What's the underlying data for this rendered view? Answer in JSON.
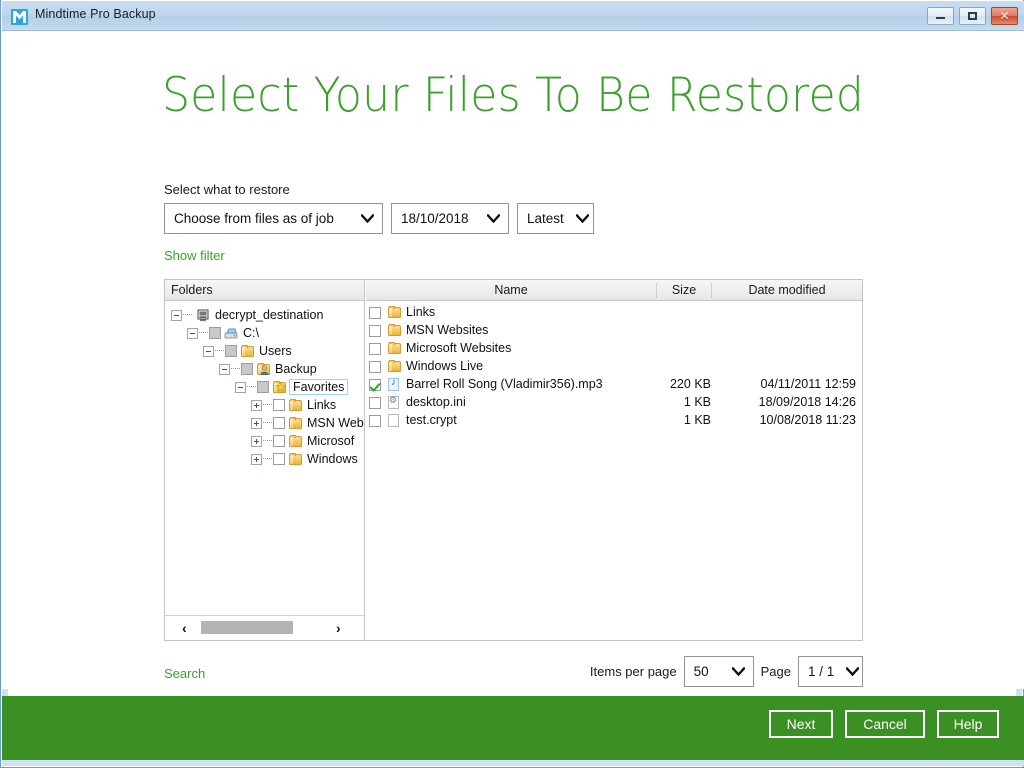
{
  "window": {
    "title": "Mindtime Pro Backup",
    "logo_icon": "mindtime-logo-icon",
    "buttons": {
      "minimize": "minimize-icon",
      "maximize": "maximize-icon",
      "close": "close-icon"
    }
  },
  "page": {
    "heading": "Select Your Files To Be Restored",
    "restore_label": "Select what to restore",
    "show_filter": "Show filter",
    "search": "Search"
  },
  "selectors": {
    "job": "Choose from files as of job",
    "date": "18/10/2018",
    "version": "Latest"
  },
  "tree": {
    "header": "Folders",
    "nodes": [
      {
        "label": "decrypt_destination",
        "depth": 0,
        "expander": "minus",
        "checkbox": "none",
        "icon": "computer-icon",
        "selected": false
      },
      {
        "label": "C:\\",
        "depth": 1,
        "expander": "minus",
        "checkbox": "partial",
        "icon": "drive-icon",
        "selected": false
      },
      {
        "label": "Users",
        "depth": 2,
        "expander": "minus",
        "checkbox": "partial",
        "icon": "folder-icon",
        "selected": false
      },
      {
        "label": "Backup",
        "depth": 3,
        "expander": "minus",
        "checkbox": "partial",
        "icon": "folder-user-icon",
        "selected": false
      },
      {
        "label": "Favorites",
        "depth": 4,
        "expander": "minus",
        "checkbox": "partial",
        "icon": "folder-star-icon",
        "selected": true
      },
      {
        "label": "Links",
        "depth": 5,
        "expander": "plus",
        "checkbox": "empty",
        "icon": "folder-icon",
        "selected": false
      },
      {
        "label": "MSN Web",
        "depth": 5,
        "expander": "plus",
        "checkbox": "empty",
        "icon": "folder-icon",
        "selected": false
      },
      {
        "label": "Microsof",
        "depth": 5,
        "expander": "plus",
        "checkbox": "empty",
        "icon": "folder-icon",
        "selected": false
      },
      {
        "label": "Windows",
        "depth": 5,
        "expander": "plus",
        "checkbox": "empty",
        "icon": "folder-icon",
        "selected": false
      }
    ],
    "scrollbar": {
      "left_arrow": "‹",
      "right_arrow": "›"
    }
  },
  "filelist": {
    "columns": [
      "Name",
      "Size",
      "Date modified"
    ],
    "rows": [
      {
        "name": "Links",
        "size": "",
        "date": "",
        "checked": false,
        "icon": "folder-icon"
      },
      {
        "name": "MSN Websites",
        "size": "",
        "date": "",
        "checked": false,
        "icon": "folder-icon"
      },
      {
        "name": "Microsoft Websites",
        "size": "",
        "date": "",
        "checked": false,
        "icon": "folder-icon"
      },
      {
        "name": "Windows Live",
        "size": "",
        "date": "",
        "checked": false,
        "icon": "folder-icon"
      },
      {
        "name": "Barrel Roll Song (Vladimir356).mp3",
        "size": "220 KB",
        "date": "04/11/2011 12:59",
        "checked": true,
        "icon": "music-file-icon"
      },
      {
        "name": "desktop.ini",
        "size": "1 KB",
        "date": "18/09/2018 14:26",
        "checked": false,
        "icon": "ini-file-icon"
      },
      {
        "name": "test.crypt",
        "size": "1 KB",
        "date": "10/08/2018 11:23",
        "checked": false,
        "icon": "generic-file-icon"
      }
    ]
  },
  "pagination": {
    "items_label": "Items per page",
    "items_value": "50",
    "page_label": "Page",
    "page_value": "1 / 1"
  },
  "footer": {
    "next": "Next",
    "cancel": "Cancel",
    "help": "Help"
  },
  "colors": {
    "brand_green": "#3a9022",
    "heading_green": "#3c9f2f",
    "titlebar_blue": "#bed7ec",
    "logo_blue": "#2ba6df"
  }
}
